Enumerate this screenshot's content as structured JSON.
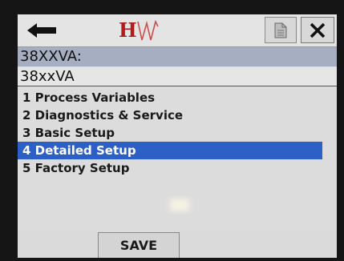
{
  "toolbar": {
    "back_icon": "left-arrow-icon",
    "logo_text": "H",
    "document_icon": "document-icon",
    "close_icon": "close-x-icon"
  },
  "device": {
    "tag": "38XXVA:",
    "model": "38xxVA"
  },
  "menu": {
    "items": [
      {
        "label": "1 Process Variables"
      },
      {
        "label": "2 Diagnostics & Service"
      },
      {
        "label": "3 Basic Setup"
      },
      {
        "label": "4 Detailed Setup",
        "selected": true
      },
      {
        "label": "5 Factory Setup"
      }
    ]
  },
  "footer": {
    "save_label": "SAVE"
  },
  "colors": {
    "selection": "#2d60c6",
    "tag_band": "#a6afc2",
    "logo_red": "#b01c1c"
  }
}
